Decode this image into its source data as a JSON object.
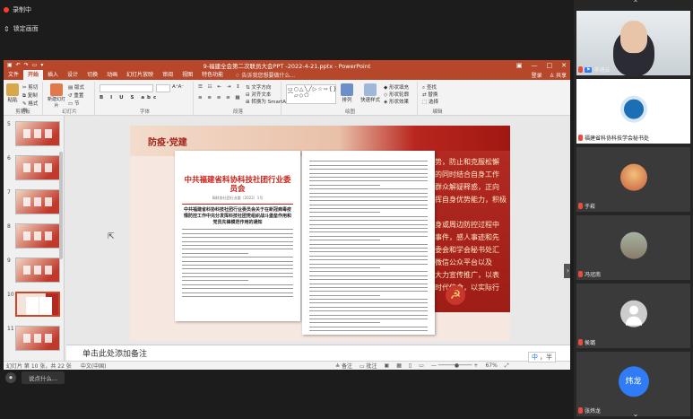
{
  "meeting": {
    "recording_label": "录制中",
    "pin_label": "锁定画面",
    "bottom_input": "说点什么..."
  },
  "ppt": {
    "title": "9-福建全会第二次联员大会PPT -2022-4-21.pptx - PowerPoint",
    "tabs": [
      "文件",
      "开始",
      "插入",
      "设计",
      "切换",
      "动画",
      "幻灯片放映",
      "审阅",
      "视图",
      "特色功能"
    ],
    "active_tab": "开始",
    "tell_me": "告诉我您想要做什么...",
    "login": "登录",
    "share": "共享",
    "ribbon": {
      "paste": "粘贴",
      "clipboard_group": "剪贴板",
      "cut": "剪切",
      "copy": "复制",
      "format_painter": "格式刷",
      "new_slide": "新建幻灯片",
      "layout": "版式",
      "reset": "重置",
      "section": "节",
      "slides_group": "幻灯片",
      "font_group": "字体",
      "paragraph_group": "段落",
      "text_direction": "文字方向",
      "align_text": "对齐文本",
      "smartart": "转换为 SmartArt",
      "drawing_group": "绘图",
      "arrange": "排列",
      "quick_styles": "快速样式",
      "shape_fill": "形状填充",
      "shape_outline": "形状轮廓",
      "shape_effects": "形状效果",
      "editing_group": "编辑",
      "find": "查找",
      "replace": "替换",
      "select": "选择"
    },
    "thumbnails": [
      {
        "num": "5",
        "style": "red"
      },
      {
        "num": "6",
        "style": "red"
      },
      {
        "num": "7",
        "style": "red"
      },
      {
        "num": "8",
        "style": "red"
      },
      {
        "num": "9",
        "style": "red"
      },
      {
        "num": "10",
        "style": "selected"
      },
      {
        "num": "11",
        "style": "red"
      }
    ],
    "slide": {
      "header": "防疫·党建",
      "doc_title": "中共福建省科协科技社团行业委员会",
      "doc_number": "闽科协社团行业委〔2022〕1号",
      "doc_subject": "中共福建省科协科技社团行业委员会关于在新冠病毒疫情防控工作中充分发挥科技社团党组织战斗堡垒作用和党员先锋模范作用的通知",
      "red_text": "形势，防止和克服松懈\n挥的同时结合自身工作\n层群众解疑释惑，正向\n发挥自身优势能力，积极\n\n自身或周边防控过程中\n点事件，感人事迹和先\n支委会和学会秘书处汇\n，微信公众平台以及\n行大力宣传推广，以表\n彰时代使命，以实际行\n"
    },
    "notes_placeholder": "单击此处添加备注",
    "status": {
      "slide_info": "幻灯片 第 10 张，共 22 张",
      "language": "中文(中国)",
      "notes": "备注",
      "comments": "批注",
      "zoom": "67%"
    }
  },
  "ime": {
    "label": "中",
    "extra": "，半"
  },
  "participants": [
    {
      "name": "李通云",
      "type": "video",
      "host": true,
      "avatar_color": "#f5f5f5"
    },
    {
      "name": "福建省科协科技学会秘书处",
      "type": "logo",
      "host": false,
      "avatar_color": "#1a6fb5"
    },
    {
      "name": "于崧",
      "type": "cartoon",
      "host": false,
      "avatar_color": "#c95a3c"
    },
    {
      "name": "冯冠南",
      "type": "photo",
      "host": false,
      "avatar_color": "#8a7b6a"
    },
    {
      "name": "侯璐",
      "type": "default",
      "host": false,
      "avatar_color": "#cccccc"
    },
    {
      "name": "张炜龙",
      "type": "initials",
      "host": false,
      "avatar_color": "#2f7cf6",
      "initials": "炜龙"
    }
  ],
  "colors": {
    "ppt_red": "#b7472a",
    "panel_bg": "#262626"
  }
}
